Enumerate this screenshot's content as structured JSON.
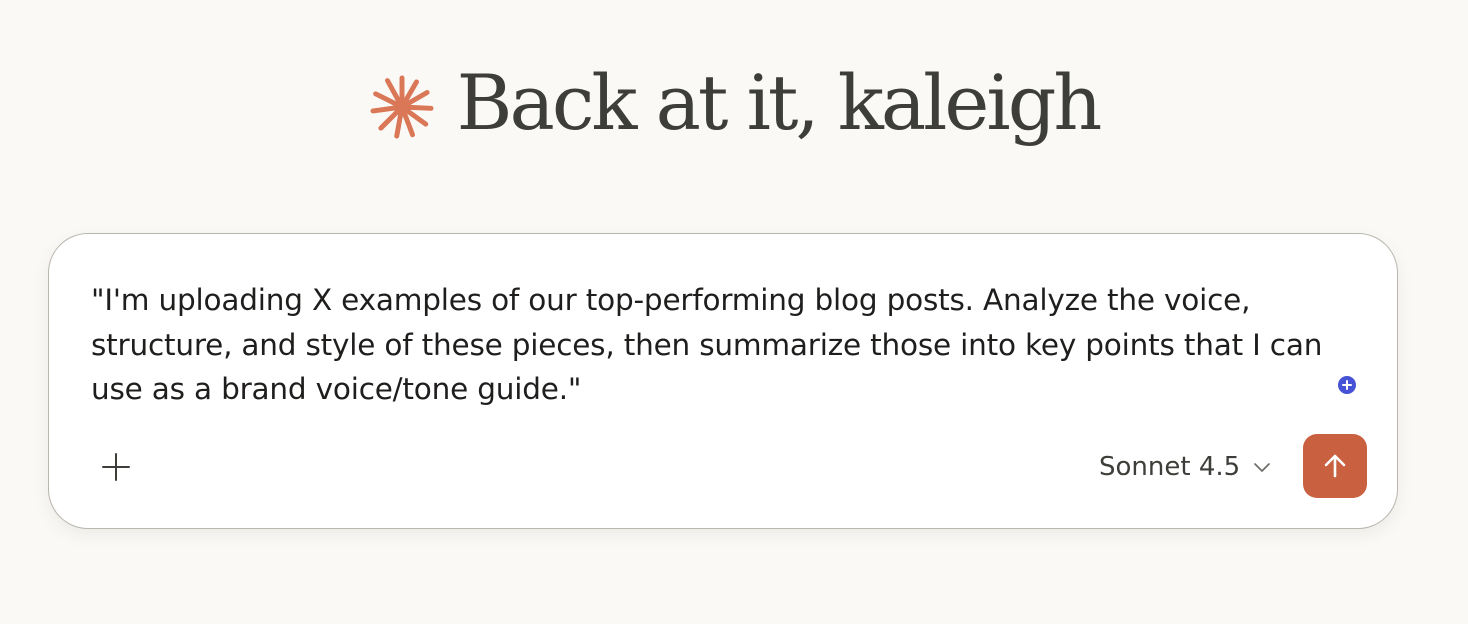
{
  "greeting": {
    "text": "Back at it, kaleigh",
    "icon": "sparkle-icon",
    "icon_color": "#d97757"
  },
  "composer": {
    "prompt_text": "\"I'm uploading X examples of our top-performing blog posts. Analyze the voice, structure, and style of these pieces, then summarize those into key points that I can use as a brand voice/tone guide.\"",
    "add_icon": "plus-icon",
    "model_label": "Sonnet 4.5",
    "model_icon": "chevron-down-icon",
    "send_icon": "arrow-up-icon",
    "send_color": "#c9603f",
    "cursor_icon": "add-cursor-icon",
    "cursor_color": "#4653d6"
  }
}
